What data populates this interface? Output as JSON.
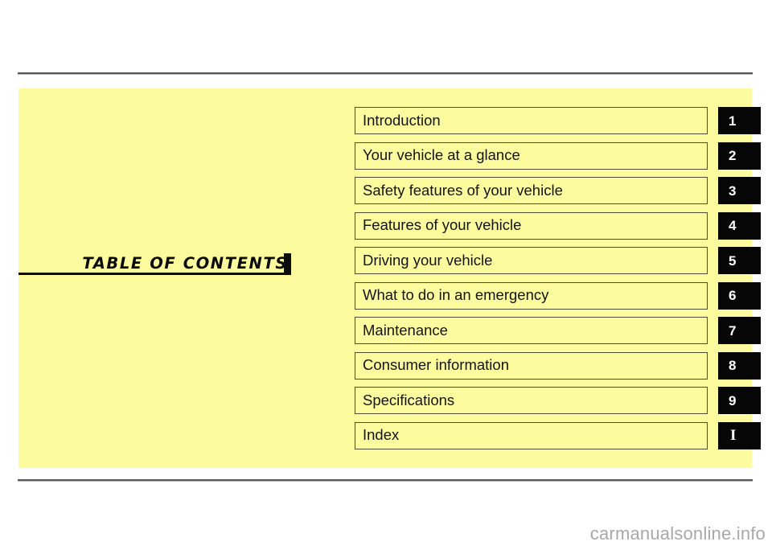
{
  "page": {
    "background_color": "#ffffff",
    "panel_color": "#fcfc9e",
    "rule_color": "#58585a",
    "badge_color": "#060606",
    "badge_text_color": "#ffffff"
  },
  "heading": {
    "title": "TABLE  OF  CONTENTS"
  },
  "contents": {
    "rows": [
      {
        "label": "Introduction",
        "badge": "1",
        "badge_style": "sans"
      },
      {
        "label": "Your vehicle at a glance",
        "badge": "2",
        "badge_style": "sans"
      },
      {
        "label": "Safety features of your vehicle",
        "badge": "3",
        "badge_style": "sans"
      },
      {
        "label": "Features of your vehicle",
        "badge": "4",
        "badge_style": "sans"
      },
      {
        "label": "Driving your vehicle",
        "badge": "5",
        "badge_style": "sans"
      },
      {
        "label": "What to do in an emergency",
        "badge": "6",
        "badge_style": "sans"
      },
      {
        "label": "Maintenance",
        "badge": "7",
        "badge_style": "sans"
      },
      {
        "label": "Consumer information",
        "badge": "8",
        "badge_style": "sans"
      },
      {
        "label": "Specifications",
        "badge": "9",
        "badge_style": "sans"
      },
      {
        "label": "Index",
        "badge": "I",
        "badge_style": "serif"
      }
    ]
  },
  "footer": {
    "watermark": "carmanualsonline.info"
  }
}
